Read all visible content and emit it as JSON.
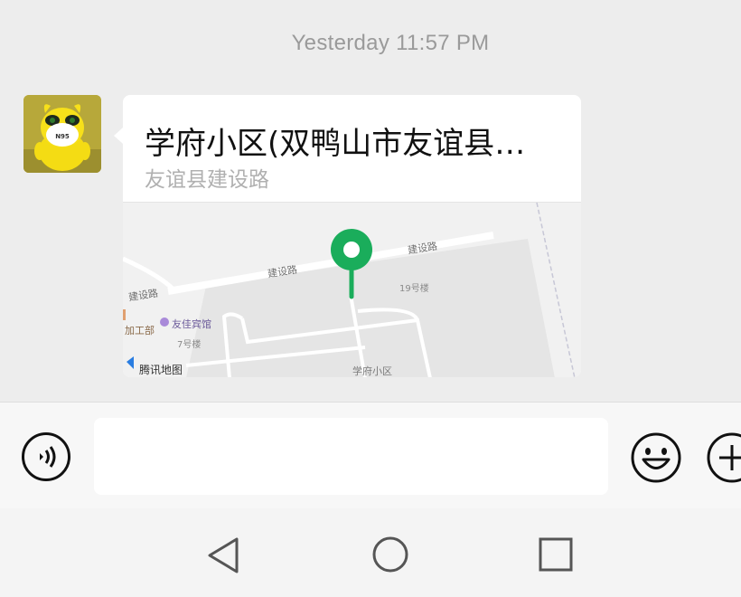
{
  "chat": {
    "timestamp": "Yesterday 11:57 PM",
    "message": {
      "type": "location",
      "title": "学府小区(双鸭山市友谊县…",
      "address": "友谊县建设路",
      "avatar": "avatar-yellow-plush-n95-mask",
      "avatar_mask_text": "N95",
      "map": {
        "labels": {
          "road_1": "建设路",
          "road_2": "建设路",
          "road_3": "建设路",
          "building_19": "19号楼",
          "building_7": "7号楼",
          "poi_hotel": "友佳宾馆",
          "poi_factory": "加工部",
          "community": "学府小区",
          "provider": "腾讯地图"
        },
        "pin_color": "#1aad5b"
      }
    }
  },
  "input_bar": {
    "voice_icon": "voice-icon",
    "text_value": "",
    "emoji_icon": "emoji-icon",
    "plus_icon": "plus-icon"
  },
  "nav_bar": {
    "back_icon": "back-triangle-icon",
    "home_icon": "home-circle-icon",
    "recents_icon": "recents-square-icon"
  }
}
